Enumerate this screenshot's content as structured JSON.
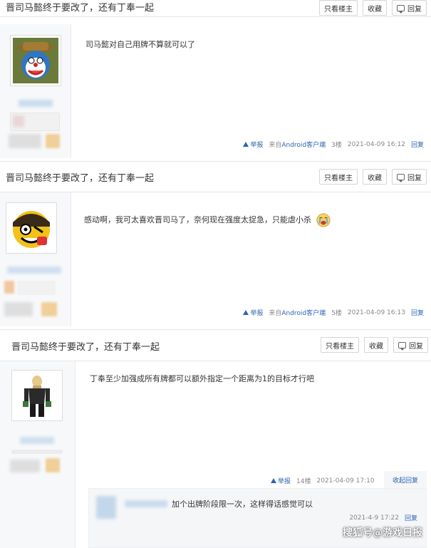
{
  "thread_title": "晋司马懿终于要改了，还有丁奉一起",
  "toolbar": {
    "only_op": "只看楼主",
    "favorite": "收藏",
    "reply": "回复"
  },
  "posts": [
    {
      "content": "司马懿对自己用牌不算就可以了",
      "report": "举报",
      "source_prefix": "来自",
      "source_client": "Android客户端",
      "floor": "3楼",
      "time": "2021-04-09 16:12",
      "reply": "回复"
    },
    {
      "content": "感动啊，我可太喜欢晋司马了，奈何现在强度太捉急，只能虐小杀",
      "report": "举报",
      "source_prefix": "来自",
      "source_client": "Android客户端",
      "floor": "5楼",
      "time": "2021-04-09 16:13",
      "reply": "回复"
    },
    {
      "content": "丁奉至少加强成所有牌都可以额外指定一个距离为1的目标才行吧",
      "report": "举报",
      "floor": "14楼",
      "time": "2021-04-09 17:10",
      "collapse_reply": "收起回复",
      "sub_reply": {
        "content": "加个出牌阶段限一次，这样得话感觉可以",
        "time": "2021-4-9 17:22",
        "reply": "回复"
      }
    }
  ],
  "watermark": "搜狐号@游戏日报",
  "colors": {
    "link": "#2d64b3",
    "sidebar_bg": "#f7f8fa",
    "lzl_bg": "#f5f6f8"
  },
  "icons": [
    "warning-triangle-icon",
    "speech-bubble-icon",
    "crying-emoji-icon"
  ]
}
